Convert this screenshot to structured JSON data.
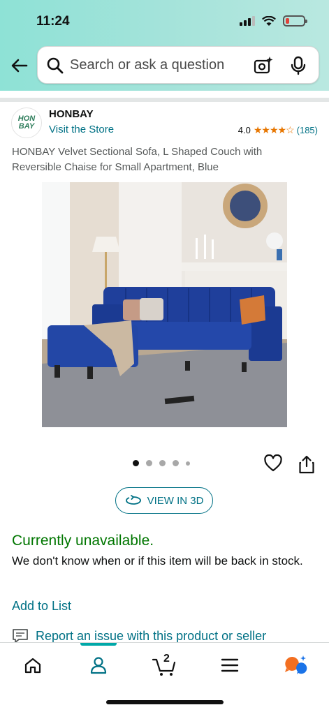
{
  "status_bar": {
    "time": "11:24"
  },
  "search": {
    "placeholder": "Search or ask a question"
  },
  "brand": {
    "logo_text": "HON BAY",
    "name": "HONBAY",
    "visit_label": "Visit the Store",
    "rating_value": "4.0",
    "stars": "★★★★☆",
    "rating_count": "(185)"
  },
  "product": {
    "title": "HONBAY Velvet Sectional Sofa, L Shaped Couch with Reversible Chaise for Small Apartment, Blue",
    "image_count": 5,
    "active_image": 1
  },
  "view3d_label": "VIEW IN 3D",
  "availability": {
    "status": "Currently unavailable.",
    "message": "We don't know when or if this item will be back in stock."
  },
  "links": {
    "add_to_list": "Add to List",
    "report": "Report an issue with this product or seller"
  },
  "bottom_nav": {
    "items": [
      "home",
      "account",
      "cart",
      "menu",
      "rufus"
    ],
    "active": "account",
    "cart_count": "2"
  },
  "colors": {
    "link": "#007185",
    "available_green": "#007600",
    "star": "#e77600",
    "header_gradient_start": "#8ee2d6",
    "header_gradient_end": "#b9e8e0"
  }
}
